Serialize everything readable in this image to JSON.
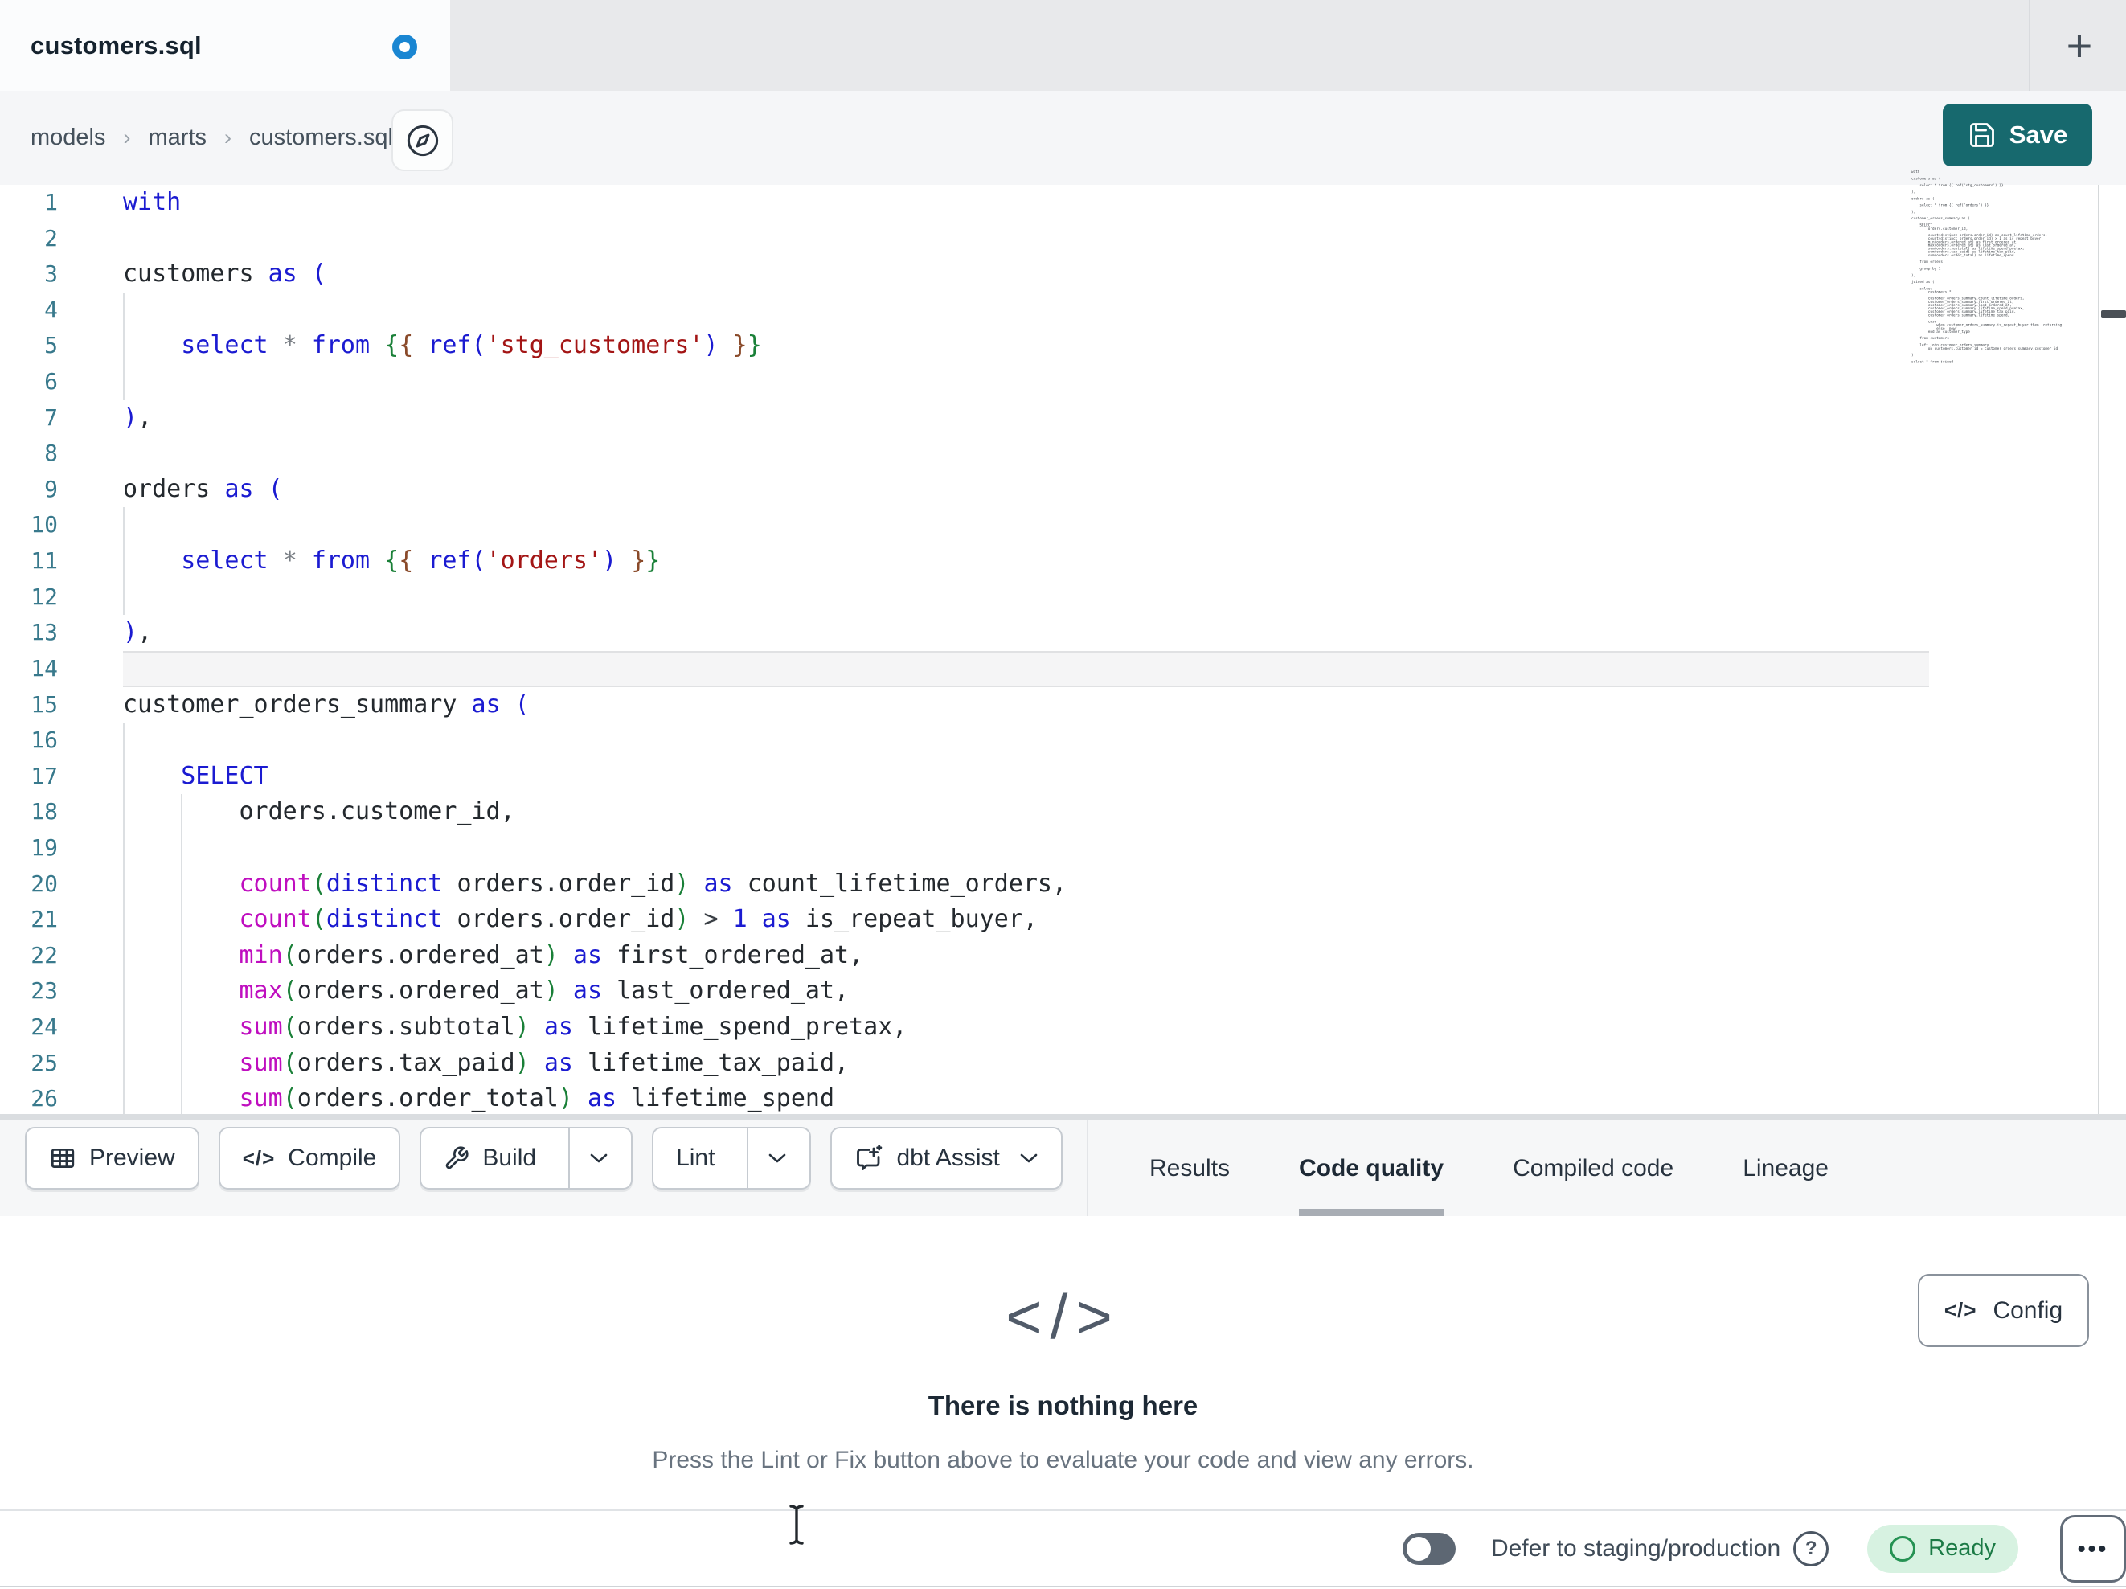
{
  "tabbar": {
    "title": "customers.sql",
    "new_tab": "+"
  },
  "breadcrumb": {
    "items": [
      "models",
      "marts",
      "customers.sql"
    ],
    "separator": "›"
  },
  "header": {
    "save_label": "Save"
  },
  "icons": {
    "code_glyph": "</>",
    "more_glyph": "•••"
  },
  "editor": {
    "lines": [
      {
        "n": "1",
        "tokens": [
          [
            "kw",
            "with"
          ]
        ],
        "guides": []
      },
      {
        "n": "2",
        "tokens": [],
        "guides": []
      },
      {
        "n": "3",
        "tokens": [
          [
            "id",
            "customers"
          ],
          [
            "pl",
            " "
          ],
          [
            "kw",
            "as"
          ],
          [
            "pl",
            " "
          ],
          [
            "b1",
            "("
          ]
        ],
        "guides": []
      },
      {
        "n": "4",
        "tokens": [],
        "guides": [
          0
        ]
      },
      {
        "n": "5",
        "tokens": [
          [
            "pl",
            "    "
          ],
          [
            "kw",
            "select"
          ],
          [
            "pl",
            " "
          ],
          [
            "op",
            "*"
          ],
          [
            "pl",
            " "
          ],
          [
            "kw",
            "from"
          ],
          [
            "pl",
            " "
          ],
          [
            "b2",
            "{"
          ],
          [
            "b3",
            "{"
          ],
          [
            "pl",
            " "
          ],
          [
            "kw",
            "ref"
          ],
          [
            "b1",
            "("
          ],
          [
            "str",
            "'stg_customers'"
          ],
          [
            "b1",
            ")"
          ],
          [
            "pl",
            " "
          ],
          [
            "b3",
            "}"
          ],
          [
            "b2",
            "}"
          ]
        ],
        "guides": [
          0
        ]
      },
      {
        "n": "6",
        "tokens": [],
        "guides": [
          0
        ]
      },
      {
        "n": "7",
        "tokens": [
          [
            "b1",
            ")"
          ],
          [
            "pl",
            ","
          ]
        ],
        "guides": []
      },
      {
        "n": "8",
        "tokens": [],
        "guides": []
      },
      {
        "n": "9",
        "tokens": [
          [
            "id",
            "orders"
          ],
          [
            "pl",
            " "
          ],
          [
            "kw",
            "as"
          ],
          [
            "pl",
            " "
          ],
          [
            "b1",
            "("
          ]
        ],
        "guides": []
      },
      {
        "n": "10",
        "tokens": [],
        "guides": [
          0
        ]
      },
      {
        "n": "11",
        "tokens": [
          [
            "pl",
            "    "
          ],
          [
            "kw",
            "select"
          ],
          [
            "pl",
            " "
          ],
          [
            "op",
            "*"
          ],
          [
            "pl",
            " "
          ],
          [
            "kw",
            "from"
          ],
          [
            "pl",
            " "
          ],
          [
            "b2",
            "{"
          ],
          [
            "b3",
            "{"
          ],
          [
            "pl",
            " "
          ],
          [
            "kw",
            "ref"
          ],
          [
            "b1",
            "("
          ],
          [
            "str",
            "'orders'"
          ],
          [
            "b1",
            ")"
          ],
          [
            "pl",
            " "
          ],
          [
            "b3",
            "}"
          ],
          [
            "b2",
            "}"
          ]
        ],
        "guides": [
          0
        ]
      },
      {
        "n": "12",
        "tokens": [],
        "guides": [
          0
        ]
      },
      {
        "n": "13",
        "tokens": [
          [
            "b1",
            ")"
          ],
          [
            "pl",
            ","
          ]
        ],
        "guides": []
      },
      {
        "n": "14",
        "hl": true,
        "tokens": [],
        "guides": []
      },
      {
        "n": "15",
        "tokens": [
          [
            "id",
            "customer_orders_summary"
          ],
          [
            "pl",
            " "
          ],
          [
            "kw",
            "as"
          ],
          [
            "pl",
            " "
          ],
          [
            "b1",
            "("
          ]
        ],
        "guides": []
      },
      {
        "n": "16",
        "tokens": [],
        "guides": [
          0
        ]
      },
      {
        "n": "17",
        "tokens": [
          [
            "pl",
            "    "
          ],
          [
            "kw",
            "SELECT"
          ]
        ],
        "guides": [
          0
        ]
      },
      {
        "n": "18",
        "tokens": [
          [
            "pl",
            "        "
          ],
          [
            "id",
            "orders.customer_id,"
          ]
        ],
        "guides": [
          0,
          4
        ]
      },
      {
        "n": "19",
        "tokens": [],
        "guides": [
          0,
          4
        ]
      },
      {
        "n": "20",
        "tokens": [
          [
            "pl",
            "        "
          ],
          [
            "fn",
            "count"
          ],
          [
            "b2",
            "("
          ],
          [
            "kw",
            "distinct"
          ],
          [
            "pl",
            " "
          ],
          [
            "id",
            "orders.order_id"
          ],
          [
            "b2",
            ")"
          ],
          [
            "pl",
            " "
          ],
          [
            "kw",
            "as"
          ],
          [
            "pl",
            " "
          ],
          [
            "id",
            "count_lifetime_orders,"
          ]
        ],
        "guides": [
          0,
          4
        ]
      },
      {
        "n": "21",
        "tokens": [
          [
            "pl",
            "        "
          ],
          [
            "fn",
            "count"
          ],
          [
            "b2",
            "("
          ],
          [
            "kw",
            "distinct"
          ],
          [
            "pl",
            " "
          ],
          [
            "id",
            "orders.order_id"
          ],
          [
            "b2",
            ")"
          ],
          [
            "pl",
            " "
          ],
          [
            "op2",
            ">"
          ],
          [
            "pl",
            " "
          ],
          [
            "num",
            "1"
          ],
          [
            "pl",
            " "
          ],
          [
            "kw",
            "as"
          ],
          [
            "pl",
            " "
          ],
          [
            "id",
            "is_repeat_buyer,"
          ]
        ],
        "guides": [
          0,
          4
        ]
      },
      {
        "n": "22",
        "tokens": [
          [
            "pl",
            "        "
          ],
          [
            "fn",
            "min"
          ],
          [
            "b2",
            "("
          ],
          [
            "id",
            "orders.ordered_at"
          ],
          [
            "b2",
            ")"
          ],
          [
            "pl",
            " "
          ],
          [
            "kw",
            "as"
          ],
          [
            "pl",
            " "
          ],
          [
            "id",
            "first_ordered_at,"
          ]
        ],
        "guides": [
          0,
          4
        ]
      },
      {
        "n": "23",
        "tokens": [
          [
            "pl",
            "        "
          ],
          [
            "fn",
            "max"
          ],
          [
            "b2",
            "("
          ],
          [
            "id",
            "orders.ordered_at"
          ],
          [
            "b2",
            ")"
          ],
          [
            "pl",
            " "
          ],
          [
            "kw",
            "as"
          ],
          [
            "pl",
            " "
          ],
          [
            "id",
            "last_ordered_at,"
          ]
        ],
        "guides": [
          0,
          4
        ]
      },
      {
        "n": "24",
        "tokens": [
          [
            "pl",
            "        "
          ],
          [
            "fn",
            "sum"
          ],
          [
            "b2",
            "("
          ],
          [
            "id",
            "orders.subtotal"
          ],
          [
            "b2",
            ")"
          ],
          [
            "pl",
            " "
          ],
          [
            "kw",
            "as"
          ],
          [
            "pl",
            " "
          ],
          [
            "id",
            "lifetime_spend_pretax,"
          ]
        ],
        "guides": [
          0,
          4
        ]
      },
      {
        "n": "25",
        "tokens": [
          [
            "pl",
            "        "
          ],
          [
            "fn",
            "sum"
          ],
          [
            "b2",
            "("
          ],
          [
            "id",
            "orders.tax_paid"
          ],
          [
            "b2",
            ")"
          ],
          [
            "pl",
            " "
          ],
          [
            "kw",
            "as"
          ],
          [
            "pl",
            " "
          ],
          [
            "id",
            "lifetime_tax_paid,"
          ]
        ],
        "guides": [
          0,
          4
        ]
      },
      {
        "n": "26",
        "tokens": [
          [
            "pl",
            "        "
          ],
          [
            "fn",
            "sum"
          ],
          [
            "b2",
            "("
          ],
          [
            "id",
            "orders.order_total"
          ],
          [
            "b2",
            ")"
          ],
          [
            "pl",
            " "
          ],
          [
            "kw",
            "as"
          ],
          [
            "pl",
            " "
          ],
          [
            "id",
            "lifetime_spend"
          ]
        ],
        "guides": [
          0,
          4
        ]
      }
    ]
  },
  "minimap_code": "with\n\ncustomers as (\n\n    select * from {{ ref('stg_customers') }}\n\n),\n\norders as (\n\n    select * from {{ ref('orders') }}\n\n),\n\ncustomer_orders_summary as (\n\n    SELECT\n        orders.customer_id,\n\n        count(distinct orders.order_id) as count_lifetime_orders,\n        count(distinct orders.order_id) > 1 as is_repeat_buyer,\n        min(orders.ordered_at) as first_ordered_at,\n        max(orders.ordered_at) as last_ordered_at,\n        sum(orders.subtotal) as lifetime_spend_pretax,\n        sum(orders.tax_paid) as lifetime_tax_paid,\n        sum(orders.order_total) as lifetime_spend\n\n    from orders\n\n    group by 1\n\n),\n\njoined as (\n\n    select\n        customers.*,\n\n        customer_orders_summary.count_lifetime_orders,\n        customer_orders_summary.first_ordered_at,\n        customer_orders_summary.last_ordered_at,\n        customer_orders_summary.lifetime_spend_pretax,\n        customer_orders_summary.lifetime_tax_paid,\n        customer_orders_summary.lifetime_spend,\n\n        case\n            when customer_orders_summary.is_repeat_buyer then 'returning'\n            else 'new'\n        end as customer_type\n\n    from customers\n\n    left join customer_orders_summary\n        on customers.customer_id = customer_orders_summary.customer_id\n\n)\n\nselect * from joined",
  "toolbar": {
    "preview": "Preview",
    "compile": "Compile",
    "build": "Build",
    "lint": "Lint",
    "assist": "dbt Assist"
  },
  "panel_tabs": {
    "results": "Results",
    "code_quality": "Code quality",
    "compiled": "Compiled code",
    "lineage": "Lineage"
  },
  "empty": {
    "title": "There is nothing here",
    "subtitle": "Press the Lint or Fix button above to evaluate your code and view any errors.",
    "config": "Config"
  },
  "statusbar": {
    "defer_label": "Defer to staging/production",
    "help_glyph": "?",
    "ready_label": "Ready"
  },
  "colors": {
    "accent_teal": "#17696e",
    "keyword_blue": "#1b1bd1",
    "function_magenta": "#bf0ebf",
    "string_red": "#a31515",
    "bracket_green": "#1a8038",
    "bracket_brown": "#8a4a2a",
    "line_number_teal": "#38798c",
    "ready_green": "#259253",
    "unsaved_dot_blue": "#1a86d2"
  }
}
